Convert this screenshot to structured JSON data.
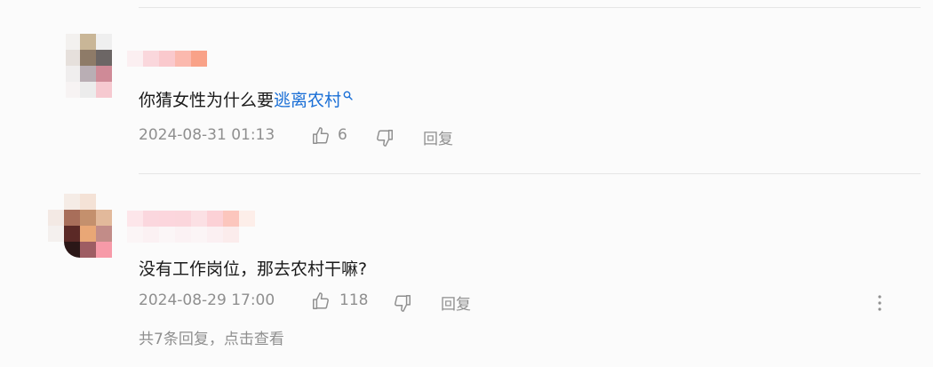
{
  "comments": [
    {
      "content_prefix": "你猜女性为什么要",
      "content_link": "逃离农村",
      "timestamp": "2024-08-31 01:13",
      "like_count": "6",
      "reply_label": "回复",
      "avatar_icon": "pixelated-avatar",
      "username_icon": "pixelated-username"
    },
    {
      "content": "没有工作岗位，那去农村干嘛?",
      "timestamp": "2024-08-29 17:00",
      "like_count": "118",
      "reply_label": "回复",
      "more_icon": "more-vertical-icon",
      "view_replies": "共7条回复，点击查看",
      "avatar_icon": "pixelated-avatar",
      "username_icon": "pixelated-username"
    }
  ],
  "colors": {
    "link": "#1a6fd6",
    "meta_text": "#8f8f8f",
    "body_text": "#1a1a1a",
    "divider": "#e6e6e6"
  }
}
